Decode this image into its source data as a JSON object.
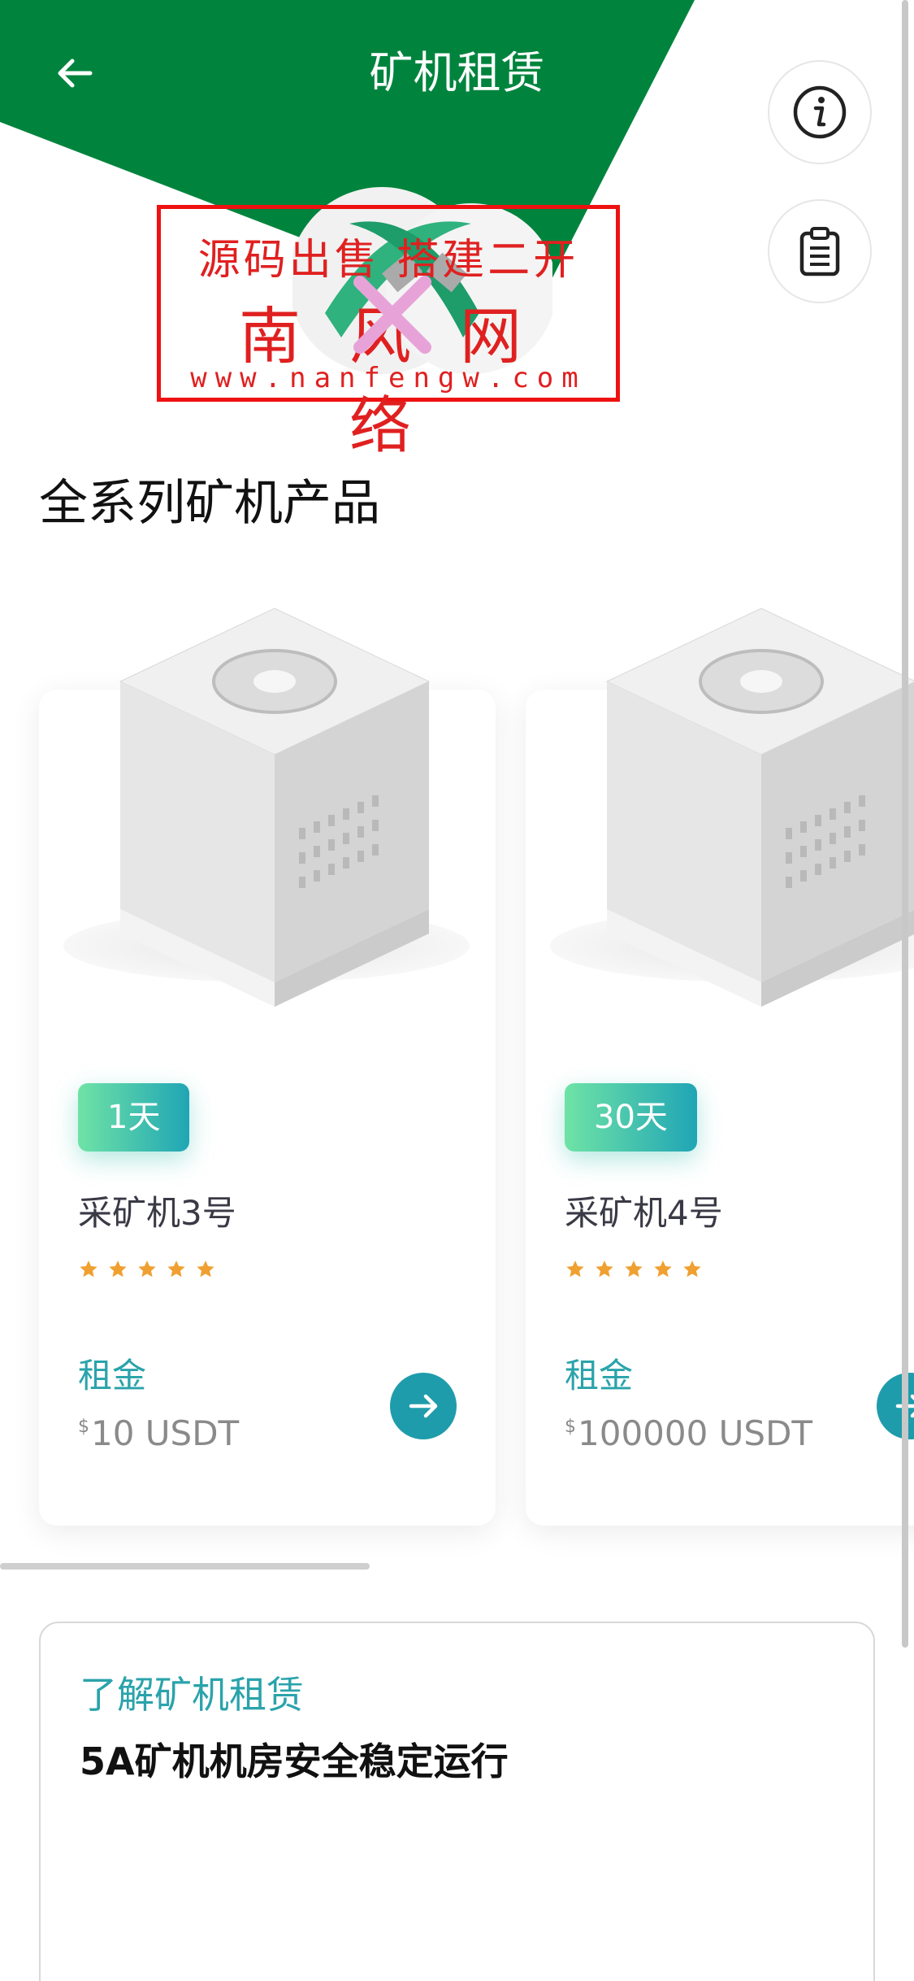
{
  "header": {
    "title": "矿机租赁"
  },
  "watermark": {
    "line1": "源码出售 搭建二开",
    "line2": "南风网络",
    "line3": "www.nanfengw.com"
  },
  "section": {
    "title": "全系列矿机产品"
  },
  "products": [
    {
      "badge": "1天",
      "name": "采矿机3号",
      "rating": 5,
      "rent_label": "租金",
      "currency_symbol": "$",
      "price": "10 USDT"
    },
    {
      "badge": "30天",
      "name": "采矿机4号",
      "rating": 5,
      "rent_label": "租金",
      "currency_symbol": "$",
      "price": "100000 USDT"
    }
  ],
  "about": {
    "label": "了解矿机租赁",
    "title": "5A矿机机房安全稳定运行"
  },
  "colors": {
    "header_green": "#00843d",
    "accent_teal": "#2aa3ab",
    "badge_gradient_start": "#6fe3a6",
    "badge_gradient_end": "#20a5b5",
    "star": "#f0a030",
    "watermark_red": "#e02020"
  },
  "icons": {
    "back": "arrow-left-icon",
    "info": "info-icon",
    "orders": "clipboard-icon",
    "arrow": "arrow-right-icon",
    "star": "star-icon"
  }
}
